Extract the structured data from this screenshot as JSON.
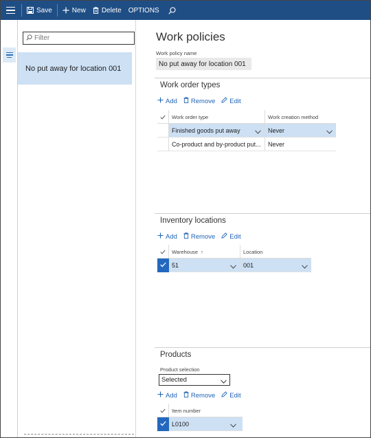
{
  "toolbar": {
    "save_label": "Save",
    "new_label": "New",
    "delete_label": "Delete",
    "options_label": "OPTIONS"
  },
  "list": {
    "filter_placeholder": "Filter",
    "items": [
      {
        "label": "No put away for location 001"
      }
    ]
  },
  "details": {
    "title": "Work policies",
    "policy_name_label": "Work policy name",
    "policy_name_value": "No put away for location 001"
  },
  "actions": {
    "add": "Add",
    "remove": "Remove",
    "edit": "Edit"
  },
  "work_order_types": {
    "title": "Work order types",
    "columns": [
      "Work order type",
      "Work creation method"
    ],
    "rows": [
      {
        "type": "Finished goods put away",
        "method": "Never",
        "selected": true
      },
      {
        "type": "Co-product and by-product put...",
        "method": "Never",
        "selected": false
      }
    ]
  },
  "inventory_locations": {
    "title": "Inventory locations",
    "columns": [
      "Warehouse",
      "Location"
    ],
    "sort_indicator": "↑",
    "rows": [
      {
        "warehouse": "51",
        "location": "001",
        "checked": true
      }
    ]
  },
  "products": {
    "title": "Products",
    "selection_label": "Product selection",
    "selection_value": "Selected",
    "columns": [
      "Item number"
    ],
    "rows": [
      {
        "item": "L0100",
        "checked": true
      }
    ]
  },
  "colors": {
    "command_bar": "#1f4e85",
    "selection": "#cde0f4",
    "link": "#1f63b6",
    "checkbox": "#2368be"
  }
}
